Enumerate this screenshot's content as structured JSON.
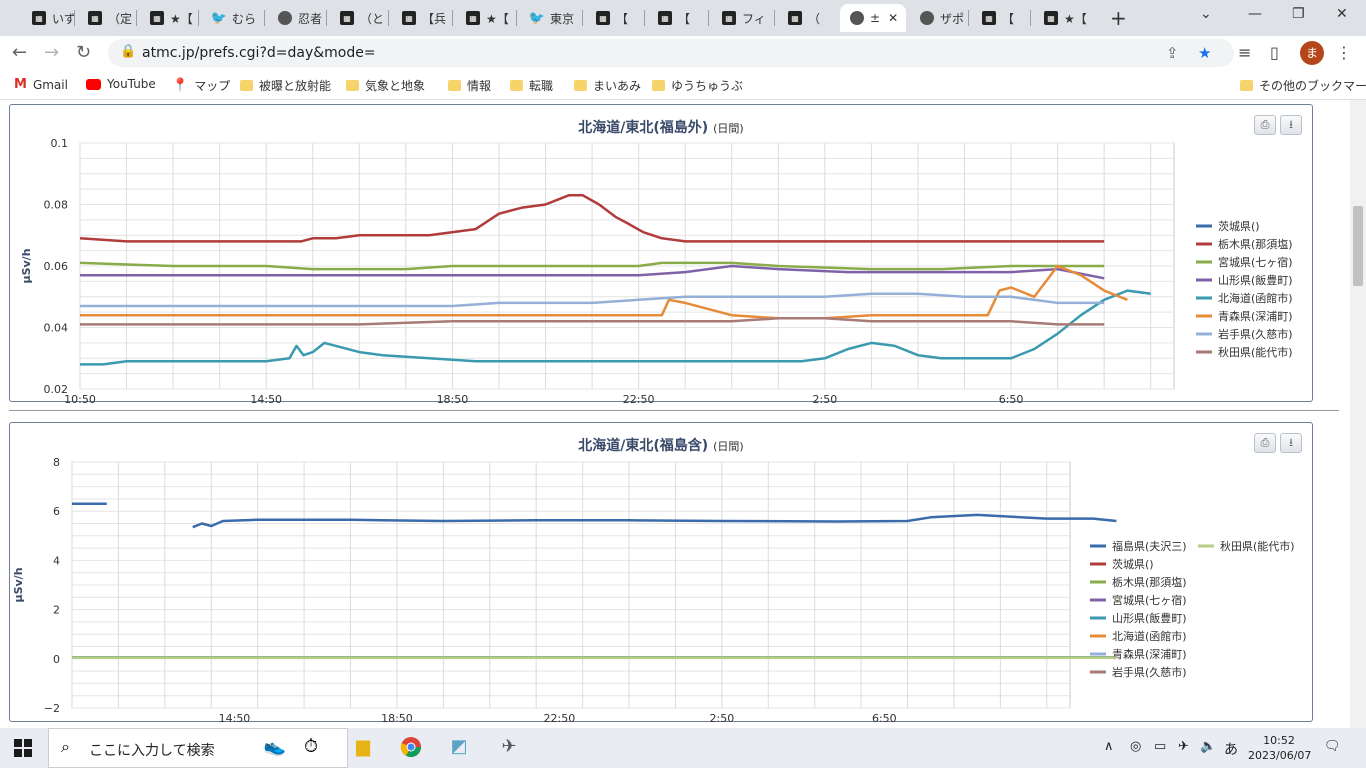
{
  "browser": {
    "tabs": [
      {
        "label": "いずれ",
        "icon": "site-icon"
      },
      {
        "label": "（定",
        "icon": "site-icon"
      },
      {
        "label": "★【",
        "icon": "site-icon"
      },
      {
        "label": "むらこ",
        "icon": "twitter-icon"
      },
      {
        "label": "忍者",
        "icon": "globe-icon"
      },
      {
        "label": "（と",
        "icon": "site-icon"
      },
      {
        "label": "【兵",
        "icon": "site-icon"
      },
      {
        "label": "★【",
        "icon": "site-icon"
      },
      {
        "label": "東京",
        "icon": "twitter-icon"
      },
      {
        "label": "【　済",
        "icon": "site-icon"
      },
      {
        "label": "【　§",
        "icon": "site-icon"
      },
      {
        "label": "フィラ",
        "icon": "site-icon"
      },
      {
        "label": "（",
        "icon": "site-icon"
      },
      {
        "label": "±",
        "icon": "globe-icon",
        "active": true
      },
      {
        "label": "ザポ",
        "icon": "globe-icon"
      },
      {
        "label": "【　フ",
        "icon": "site-icon"
      },
      {
        "label": "★【",
        "icon": "site-icon"
      }
    ],
    "url": "atmc.jp/prefs.cgi?d=day&mode=",
    "profile_initial": "ま",
    "bookmarks": [
      {
        "label": "Gmail",
        "icon": "gmail-icon"
      },
      {
        "label": "YouTube",
        "icon": "youtube-icon"
      },
      {
        "label": "マップ",
        "icon": "maps-icon"
      },
      {
        "label": "被曝と放射能",
        "icon": "folder-icon"
      },
      {
        "label": "気象と地象",
        "icon": "folder-icon"
      },
      {
        "label": "情報",
        "icon": "folder-icon"
      },
      {
        "label": "転職",
        "icon": "folder-icon"
      },
      {
        "label": "まいあみ",
        "icon": "folder-icon"
      },
      {
        "label": "ゆうちゅうぶ",
        "icon": "folder-icon"
      }
    ],
    "other_bookmarks": "その他のブックマーク"
  },
  "panels": [
    {
      "title": "北海道/東北(福島外)",
      "subtitle": "(日間)"
    },
    {
      "title": "北海道/東北(福島含)",
      "subtitle": "(日間)"
    }
  ],
  "chart_data": [
    {
      "type": "line",
      "title": "北海道/東北(福島外)",
      "subtitle": "(日間)",
      "ylabel": "μSv/h",
      "ylim": [
        0.02,
        0.1
      ],
      "yticks": [
        "0.1",
        "0.08",
        "0.06",
        "0.04",
        "0.02"
      ],
      "xticks": [
        "10:50",
        "14:50",
        "18:50",
        "22:50",
        "2:50",
        "6:50"
      ],
      "legend_position": "right",
      "grid": true,
      "series": [
        {
          "name": "茨城県()",
          "color": "#3b6bab",
          "values": []
        },
        {
          "name": "栃木県(那須塩)",
          "color": "#b23b3b",
          "values": [
            [
              0,
              0.069
            ],
            [
              2,
              0.068
            ],
            [
              4,
              0.068
            ],
            [
              8,
              0.068
            ],
            [
              9.5,
              0.068
            ],
            [
              10,
              0.069
            ],
            [
              11,
              0.069
            ],
            [
              12,
              0.07
            ],
            [
              15,
              0.07
            ],
            [
              17,
              0.072
            ],
            [
              18,
              0.077
            ],
            [
              19,
              0.079
            ],
            [
              20,
              0.08
            ],
            [
              21,
              0.083
            ],
            [
              21.6,
              0.083
            ],
            [
              22.3,
              0.08
            ],
            [
              23,
              0.076
            ],
            [
              23.5,
              0.074
            ],
            [
              24.2,
              0.071
            ],
            [
              25,
              0.069
            ],
            [
              26,
              0.068
            ],
            [
              28,
              0.068
            ],
            [
              30,
              0.068
            ],
            [
              34,
              0.068
            ],
            [
              37,
              0.068
            ],
            [
              40,
              0.068
            ],
            [
              44,
              0.068
            ]
          ]
        },
        {
          "name": "宮城県(七ヶ宿)",
          "color": "#8aab4a",
          "values": [
            [
              0,
              0.061
            ],
            [
              4,
              0.06
            ],
            [
              8,
              0.06
            ],
            [
              10,
              0.059
            ],
            [
              14,
              0.059
            ],
            [
              16,
              0.06
            ],
            [
              18,
              0.06
            ],
            [
              21,
              0.06
            ],
            [
              24,
              0.06
            ],
            [
              25,
              0.061
            ],
            [
              28,
              0.061
            ],
            [
              30,
              0.06
            ],
            [
              34,
              0.059
            ],
            [
              37,
              0.059
            ],
            [
              40,
              0.06
            ],
            [
              44,
              0.06
            ]
          ]
        },
        {
          "name": "山形県(飯豊町)",
          "color": "#7f62a8",
          "values": [
            [
              0,
              0.057
            ],
            [
              4,
              0.057
            ],
            [
              8,
              0.057
            ],
            [
              12,
              0.057
            ],
            [
              16,
              0.057
            ],
            [
              20,
              0.057
            ],
            [
              24,
              0.057
            ],
            [
              26,
              0.058
            ],
            [
              28,
              0.06
            ],
            [
              30,
              0.059
            ],
            [
              33,
              0.058
            ],
            [
              36,
              0.058
            ],
            [
              40,
              0.058
            ],
            [
              42,
              0.059
            ],
            [
              44,
              0.056
            ]
          ]
        },
        {
          "name": "北海道(函館市)",
          "color": "#3a9ab0",
          "values": [
            [
              0,
              0.028
            ],
            [
              1,
              0.028
            ],
            [
              2,
              0.029
            ],
            [
              3,
              0.029
            ],
            [
              4,
              0.029
            ],
            [
              6,
              0.029
            ],
            [
              8,
              0.029
            ],
            [
              9,
              0.03
            ],
            [
              9.3,
              0.034
            ],
            [
              9.6,
              0.031
            ],
            [
              10,
              0.032
            ],
            [
              10.5,
              0.035
            ],
            [
              11,
              0.034
            ],
            [
              12,
              0.032
            ],
            [
              13,
              0.031
            ],
            [
              15,
              0.03
            ],
            [
              17,
              0.029
            ],
            [
              20,
              0.029
            ],
            [
              24,
              0.029
            ],
            [
              28,
              0.029
            ],
            [
              31,
              0.029
            ],
            [
              32,
              0.03
            ],
            [
              33,
              0.033
            ],
            [
              34,
              0.035
            ],
            [
              35,
              0.034
            ],
            [
              36,
              0.031
            ],
            [
              37,
              0.03
            ],
            [
              39,
              0.03
            ],
            [
              40,
              0.03
            ],
            [
              41,
              0.033
            ],
            [
              42,
              0.038
            ],
            [
              43,
              0.044
            ],
            [
              44,
              0.049
            ],
            [
              45,
              0.052
            ],
            [
              46,
              0.051
            ]
          ]
        },
        {
          "name": "青森県(深浦町)",
          "color": "#e58b3a",
          "values": [
            [
              0,
              0.044
            ],
            [
              4,
              0.044
            ],
            [
              8,
              0.044
            ],
            [
              12,
              0.044
            ],
            [
              16,
              0.044
            ],
            [
              20,
              0.044
            ],
            [
              24,
              0.044
            ],
            [
              25,
              0.044
            ],
            [
              25.3,
              0.049
            ],
            [
              26,
              0.048
            ],
            [
              27,
              0.046
            ],
            [
              28,
              0.044
            ],
            [
              30,
              0.043
            ],
            [
              32,
              0.043
            ],
            [
              34,
              0.044
            ],
            [
              36,
              0.044
            ],
            [
              38,
              0.044
            ],
            [
              39,
              0.044
            ],
            [
              39.5,
              0.052
            ],
            [
              40,
              0.053
            ],
            [
              41,
              0.05
            ],
            [
              42,
              0.06
            ],
            [
              43,
              0.057
            ],
            [
              44,
              0.052
            ],
            [
              45,
              0.049
            ]
          ]
        },
        {
          "name": "岩手県(久慈市)",
          "color": "#94b0d8",
          "values": [
            [
              0,
              0.047
            ],
            [
              4,
              0.047
            ],
            [
              8,
              0.047
            ],
            [
              12,
              0.047
            ],
            [
              16,
              0.047
            ],
            [
              18,
              0.048
            ],
            [
              20,
              0.048
            ],
            [
              22,
              0.048
            ],
            [
              24,
              0.049
            ],
            [
              26,
              0.05
            ],
            [
              28,
              0.05
            ],
            [
              30,
              0.05
            ],
            [
              32,
              0.05
            ],
            [
              34,
              0.051
            ],
            [
              36,
              0.051
            ],
            [
              38,
              0.05
            ],
            [
              40,
              0.05
            ],
            [
              42,
              0.048
            ],
            [
              44,
              0.048
            ]
          ]
        },
        {
          "name": "秋田県(能代市)",
          "color": "#a87a78",
          "values": [
            [
              0,
              0.041
            ],
            [
              4,
              0.041
            ],
            [
              8,
              0.041
            ],
            [
              12,
              0.041
            ],
            [
              16,
              0.042
            ],
            [
              20,
              0.042
            ],
            [
              24,
              0.042
            ],
            [
              26,
              0.042
            ],
            [
              28,
              0.042
            ],
            [
              30,
              0.043
            ],
            [
              32,
              0.043
            ],
            [
              34,
              0.042
            ],
            [
              36,
              0.042
            ],
            [
              38,
              0.042
            ],
            [
              40,
              0.042
            ],
            [
              42,
              0.041
            ],
            [
              44,
              0.041
            ]
          ]
        }
      ]
    },
    {
      "type": "line",
      "title": "北海道/東北(福島含)",
      "subtitle": "(日間)",
      "ylabel": "μSv/h",
      "ylim": [
        -2,
        8
      ],
      "yticks": [
        "8",
        "6",
        "4",
        "2",
        "0",
        "−2"
      ],
      "xticks": [
        "14:50",
        "18:50",
        "22:50",
        "2:50",
        "6:50"
      ],
      "legend_position": "right",
      "grid": true,
      "series": [
        {
          "name": "福島県(夫沢三)",
          "color": "#3b6bab",
          "segments": [
            [
              [
                0,
                6.3
              ],
              [
                1.5,
                6.3
              ]
            ],
            [
              [
                5.2,
                5.35
              ],
              [
                5.6,
                5.5
              ],
              [
                6,
                5.4
              ],
              [
                6.5,
                5.6
              ],
              [
                8,
                5.65
              ],
              [
                12,
                5.65
              ],
              [
                16,
                5.6
              ],
              [
                20,
                5.63
              ],
              [
                24,
                5.63
              ],
              [
                28,
                5.6
              ],
              [
                33,
                5.58
              ],
              [
                36,
                5.6
              ],
              [
                37,
                5.75
              ],
              [
                39,
                5.85
              ],
              [
                40,
                5.8
              ],
              [
                42,
                5.7
              ],
              [
                44,
                5.7
              ],
              [
                45,
                5.6
              ]
            ]
          ]
        },
        {
          "name": "茨城県()",
          "color": "#b23b3b",
          "values": [
            [
              0,
              0.06
            ],
            [
              45,
              0.06
            ]
          ]
        },
        {
          "name": "栃木県(那須塩)",
          "color": "#8aab4a",
          "values": [
            [
              0,
              0.06
            ],
            [
              45,
              0.06
            ]
          ]
        },
        {
          "name": "宮城県(七ヶ宿)",
          "color": "#7f62a8",
          "values": [
            [
              0,
              0.05
            ],
            [
              45,
              0.05
            ]
          ]
        },
        {
          "name": "山形県(飯豊町)",
          "color": "#3a9ab0",
          "values": [
            [
              0,
              0.05
            ],
            [
              45,
              0.05
            ]
          ]
        },
        {
          "name": "北海道(函館市)",
          "color": "#e58b3a",
          "values": [
            [
              0,
              0.04
            ],
            [
              45,
              0.04
            ]
          ]
        },
        {
          "name": "青森県(深浦町)",
          "color": "#94b0d8",
          "values": [
            [
              0,
              0.05
            ],
            [
              45,
              0.05
            ]
          ]
        },
        {
          "name": "岩手県(久慈市)",
          "color": "#a87a78",
          "values": [
            [
              0,
              0.04
            ],
            [
              45,
              0.04
            ]
          ]
        },
        {
          "name": "秋田県(能代市)",
          "color": "#b5cf88",
          "values": [
            [
              0,
              0.04
            ],
            [
              45,
              0.04
            ]
          ]
        }
      ]
    }
  ],
  "taskbar": {
    "search_placeholder": "ここに入力して検索",
    "ime": "あ",
    "time": "10:52",
    "date": "2023/06/07"
  }
}
